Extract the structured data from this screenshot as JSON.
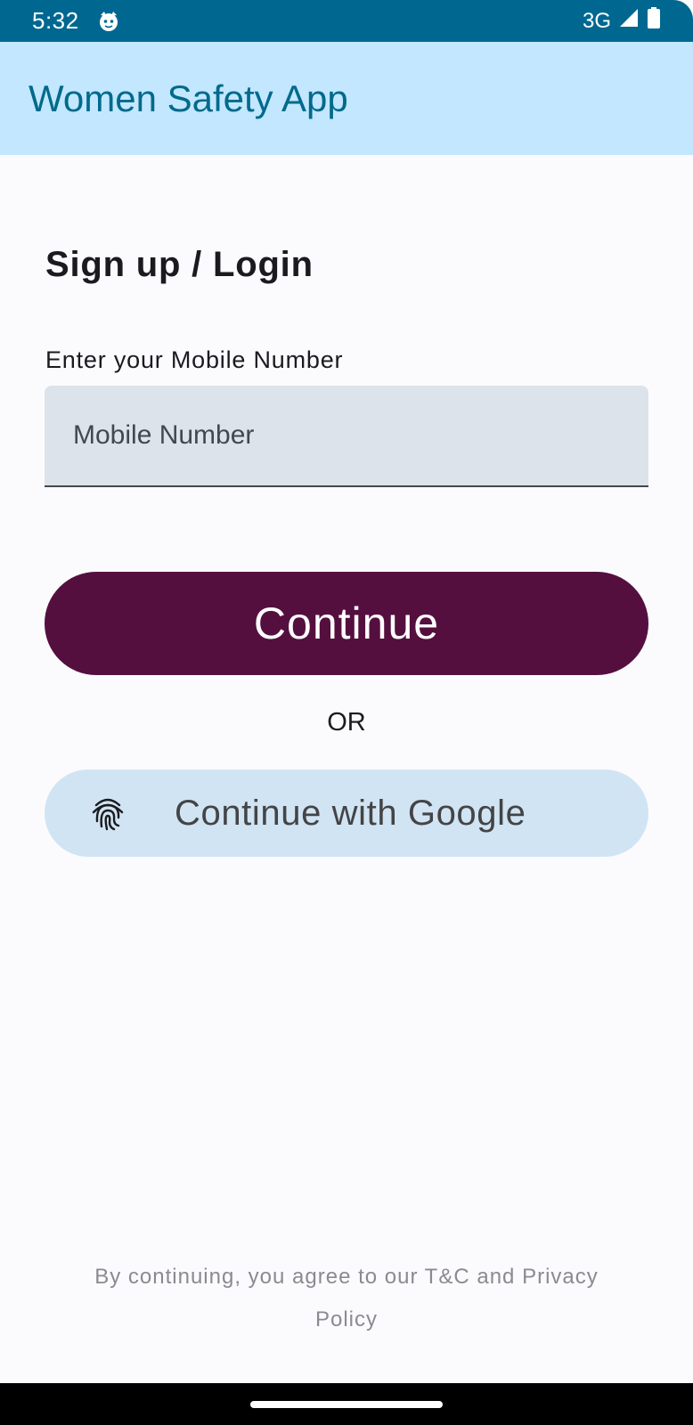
{
  "status_bar": {
    "time": "5:32",
    "network": "3G",
    "icons": [
      "cat-notification-icon",
      "signal-icon",
      "battery-icon"
    ]
  },
  "app_bar": {
    "title": "Women Safety App"
  },
  "main": {
    "heading": "Sign up / Login",
    "mobile_label": "Enter your Mobile Number",
    "mobile_input": {
      "value": "",
      "placeholder": "Mobile Number"
    },
    "continue_label": "Continue",
    "or_text": "OR",
    "google_label": "Continue with Google",
    "google_icon": "fingerprint-icon",
    "terms": "By continuing, you agree to our T&C and Privacy Policy"
  },
  "colors": {
    "status_bar": "#006890",
    "app_bar": "#c2e7fe",
    "app_title": "#006a8c",
    "continue_button": "#550f3f",
    "google_button": "#d1e4f4",
    "input_background": "#dce3ea"
  }
}
